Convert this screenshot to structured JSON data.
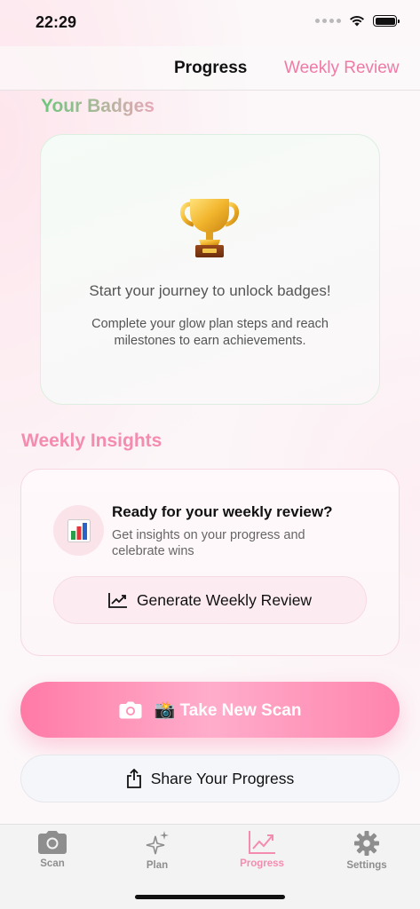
{
  "status_bar": {
    "time": "22:29"
  },
  "header": {
    "progress_label": "Progress",
    "weekly_review_label": "Weekly Review"
  },
  "badges": {
    "title": "Your Badges",
    "headline": "Start your journey to unlock badges!",
    "subtitle": "Complete your glow plan steps and reach milestones to earn achievements."
  },
  "insights": {
    "title": "Weekly Insights",
    "review_title": "Ready for your weekly review?",
    "review_subtitle": "Get insights on your progress and celebrate wins",
    "generate_label": "Generate Weekly Review"
  },
  "actions": {
    "scan_label": "📸 Take New Scan",
    "share_label": "Share Your Progress"
  },
  "tab_bar": {
    "items": [
      {
        "label": "Scan",
        "icon": "camera-icon"
      },
      {
        "label": "Plan",
        "icon": "sparkles-icon"
      },
      {
        "label": "Progress",
        "icon": "chart-icon",
        "active": true
      },
      {
        "label": "Settings",
        "icon": "gear-icon"
      }
    ]
  },
  "colors": {
    "accent": "#f48cb0",
    "scan_button": "#ff7aa6",
    "badge_title_start": "#6cc77b"
  }
}
